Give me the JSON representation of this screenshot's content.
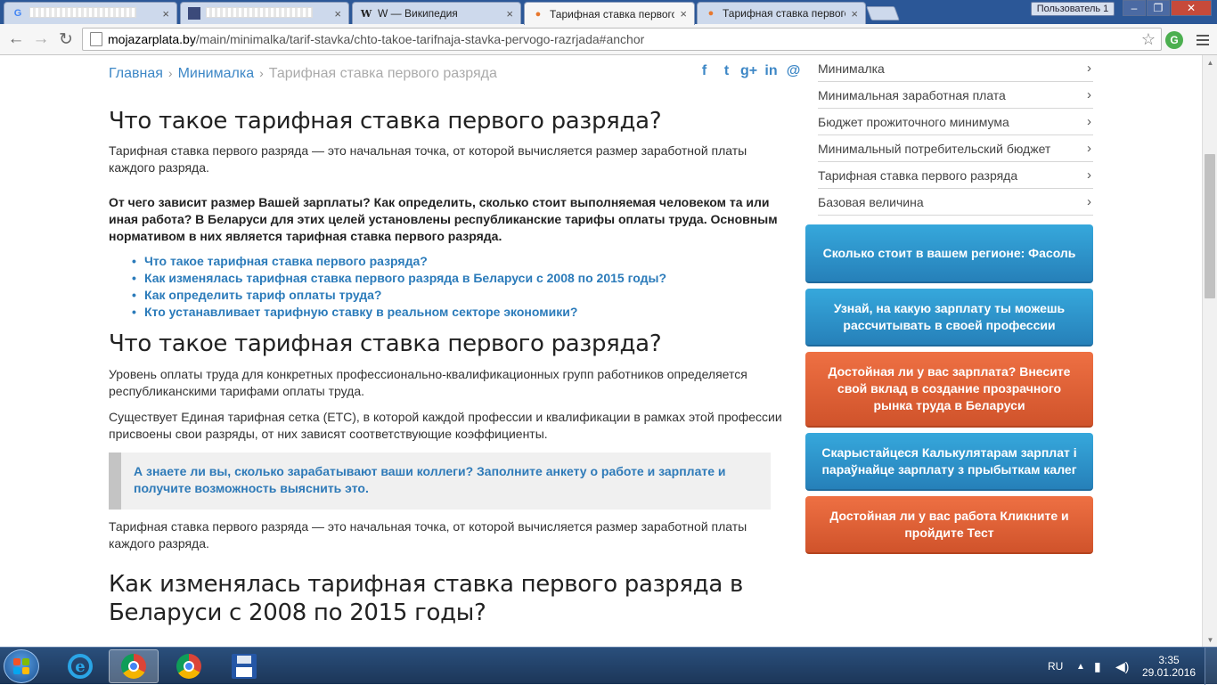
{
  "browser": {
    "tabs": [
      {
        "title": "G",
        "redacted": true
      },
      {
        "title": "",
        "redacted": true
      },
      {
        "title": "W         — Википедия"
      },
      {
        "title": "Тарифная ставка первого р"
      },
      {
        "title": "Тарифная ставка первого р"
      }
    ],
    "user_label": "Пользователь 1",
    "url_host": "mojazarplata.by",
    "url_path": "/main/minimalka/tarif-stavka/chto-takoe-tarifnaja-stavka-pervogo-razrjada#anchor"
  },
  "breadcrumb": {
    "home": "Главная",
    "section": "Минималка",
    "current": "Тарифная ставка первого разряда"
  },
  "social": {
    "facebook": "f",
    "twitter": "t",
    "gplus": "g+",
    "linkedin": "in",
    "email": "@"
  },
  "article": {
    "h1": "Что такое тарифная ставка первого разряда?",
    "intro": "Тарифная ставка первого разряда — это начальная точка, от которой вычисляется размер заработной платы каждого разряда.",
    "lead": "От чего зависит размер Вашей зарплаты? Как определить, сколько стоит выполняемая человеком та или иная работа? В Беларуси для этих целей установлены республиканские тарифы оплаты труда. Основным нормативом в них является тарифная ставка первого разряда.",
    "toc": [
      "Что такое тарифная ставка первого разряда?",
      "Как изменялась тарифная ставка первого разряда в Беларуси с 2008 по 2015 годы?",
      "Как определить тариф оплаты труда?",
      "Кто устанавливает тарифную ставку в реальном секторе экономики?"
    ],
    "h2": "Что такое тарифная ставка первого разряда?",
    "p1": "Уровень оплаты труда для конкретных профессионально-квалификационных групп работников определяется республиканскими тарифами оплаты труда.",
    "p2": "Существует Единая тарифная сетка (ЕТС), в которой каждой профессии и квалификации в рамках этой профессии присвоены свои разряды, от них зависят соответствующие коэффициенты.",
    "note": "А знаете ли вы, сколько зарабатывают ваши коллеги? Заполните анкету о работе и зарплате и получите возможность выяснить это.",
    "p3": "Тарифная ставка первого разряда — это начальная точка, от которой вычисляется размер заработной платы каждого разряда.",
    "h3": "Как изменялась тарифная ставка первого разряда в Беларуси с 2008 по 2015 годы?"
  },
  "sidebar": {
    "menu": [
      "Минималка",
      "Минимальная заработная плата",
      "Бюджет прожиточного минимума",
      "Минимальный потребительский бюджет",
      "Тарифная ставка первого разряда",
      "Базовая величина"
    ],
    "promos": [
      {
        "text": "Сколько стоит в вашем регионе: Фасоль",
        "color": "blue"
      },
      {
        "text": "Узнай, на какую зарплату ты можешь рассчитывать в своей профессии",
        "color": "blue"
      },
      {
        "text": "Достойная ли у вас зарплата? Внесите свой вклад в создание прозрачного рынка труда в Беларуси",
        "color": "orange"
      },
      {
        "text": "Скарыстайцеся Калькулятарам зарплат і параўнайце зарплату з прыбыткам калег",
        "color": "blue"
      },
      {
        "text": "Достойная ли у вас работа Кликните и пройдите Тест",
        "color": "orange"
      }
    ]
  },
  "taskbar": {
    "lang": "RU",
    "time": "3:35",
    "date": "29.01.2016"
  },
  "colors": {
    "link": "#3d87c6",
    "promo_blue": "#2d8fc8",
    "promo_orange": "#e0623a"
  }
}
